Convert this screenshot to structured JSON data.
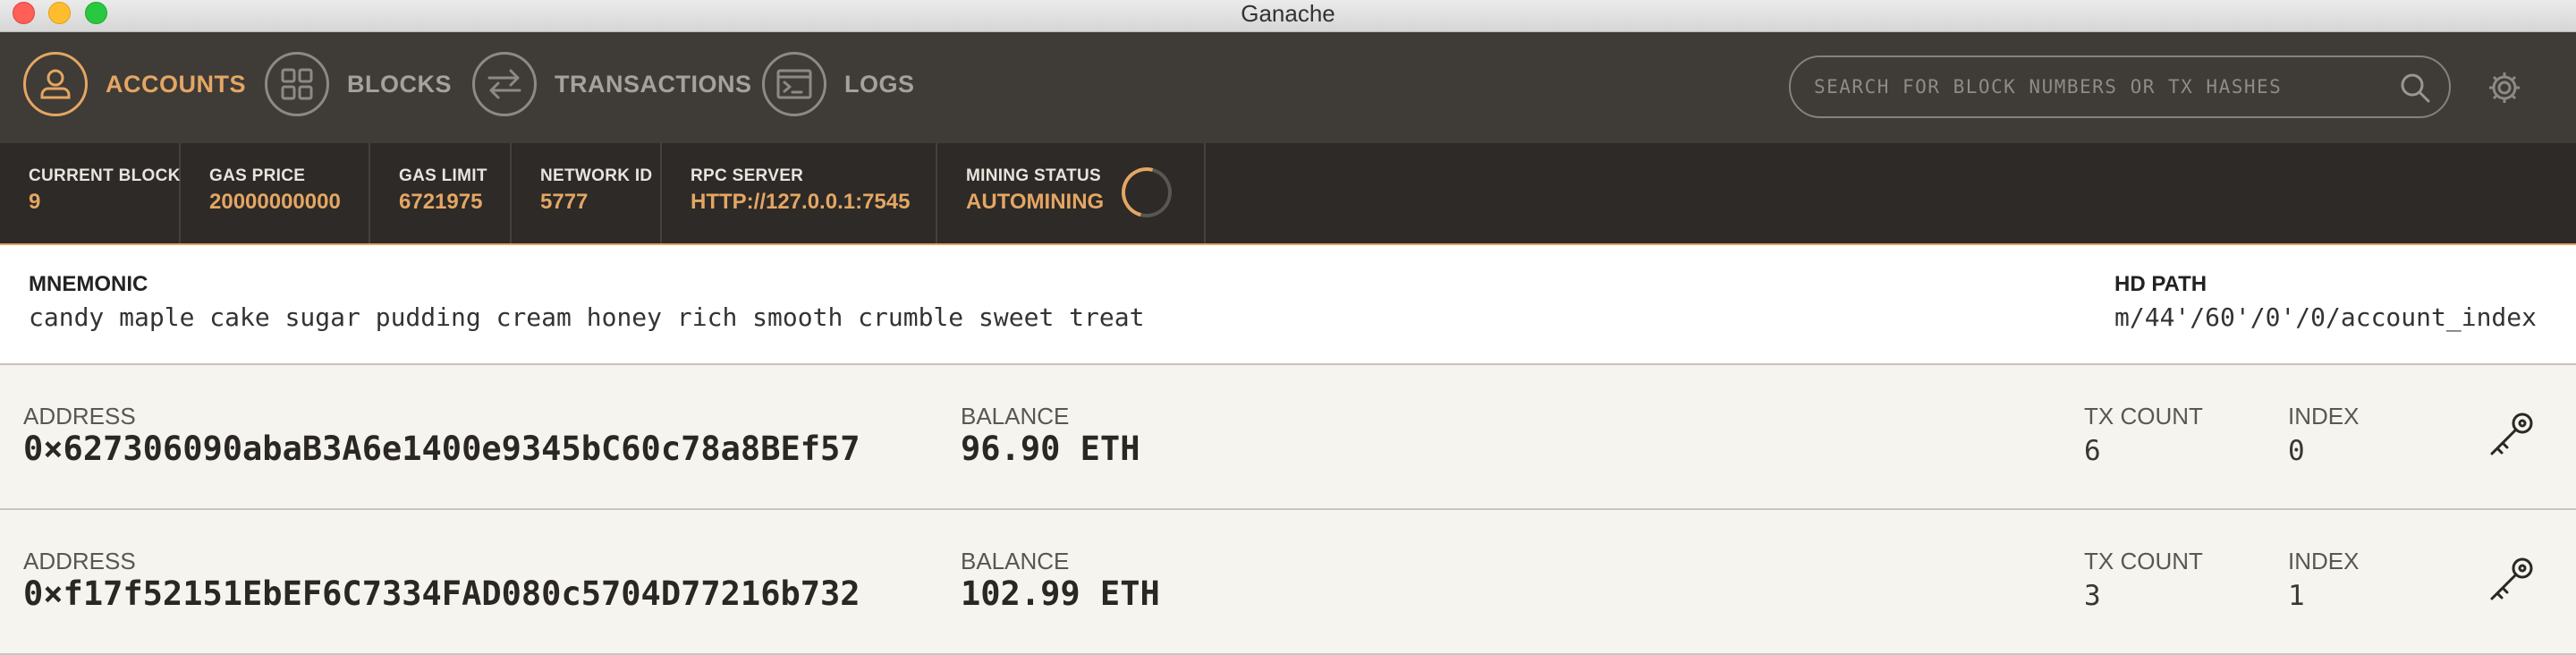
{
  "window": {
    "title": "Ganache"
  },
  "nav": {
    "items": [
      {
        "label": "ACCOUNTS",
        "icon": "user-icon",
        "active": true
      },
      {
        "label": "BLOCKS",
        "icon": "blocks-grid-icon",
        "active": false
      },
      {
        "label": "TRANSACTIONS",
        "icon": "swap-arrows-icon",
        "active": false
      },
      {
        "label": "LOGS",
        "icon": "terminal-icon",
        "active": false
      }
    ],
    "search_placeholder": "SEARCH FOR BLOCK NUMBERS OR TX HASHES",
    "settings_icon": "gear-icon"
  },
  "stats": [
    {
      "label": "CURRENT BLOCK",
      "value": "9"
    },
    {
      "label": "GAS PRICE",
      "value": "20000000000"
    },
    {
      "label": "GAS LIMIT",
      "value": "6721975"
    },
    {
      "label": "NETWORK ID",
      "value": "5777"
    },
    {
      "label": "RPC SERVER",
      "value": "HTTP://127.0.0.1:7545"
    },
    {
      "label": "MINING STATUS",
      "value": "AUTOMINING"
    }
  ],
  "mnemonic": {
    "label": "MNEMONIC",
    "value": "candy maple cake sugar pudding cream honey rich smooth crumble sweet treat",
    "hd_path_label": "HD PATH",
    "hd_path_value": "m/44'/60'/0'/0/account_index"
  },
  "accounts": [
    {
      "address_label": "ADDRESS",
      "address": "0×627306090abaB3A6e1400e9345bC60c78a8BEf57",
      "balance_label": "BALANCE",
      "balance": "96.90 ETH",
      "tx_count_label": "TX COUNT",
      "tx_count": "6",
      "index_label": "INDEX",
      "index": "0"
    },
    {
      "address_label": "ADDRESS",
      "address": "0×f17f52151EbEF6C7334FAD080c5704D77216b732",
      "balance_label": "BALANCE",
      "balance": "102.99 ETH",
      "tx_count_label": "TX COUNT",
      "tx_count": "3",
      "index_label": "INDEX",
      "index": "1"
    }
  ],
  "colors": {
    "accent": "#e4a663",
    "nav_bg": "#3f3b37",
    "stats_bg": "#2d2a27",
    "row_bg": "#f6f4ef"
  }
}
